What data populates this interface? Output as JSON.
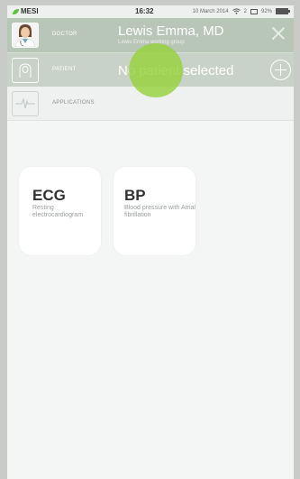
{
  "statusbar": {
    "brand": "MESI",
    "time": "16:32",
    "date": "10 March 2014",
    "mail_count": "2",
    "battery": "92%"
  },
  "doctor_row": {
    "label": "DOCTOR",
    "name": "Lewis Emma, MD",
    "group": "Lewis Emma working group"
  },
  "patient_row": {
    "label": "PATIENT",
    "status": "No patient selected"
  },
  "apps_row": {
    "label": "APPLICATIONS"
  },
  "apps": [
    {
      "title": "ECG",
      "desc": "Resting electrocardiogram"
    },
    {
      "title": "BP",
      "desc": "Blood pressure with Atrial fibrillation"
    }
  ],
  "icons": {
    "brand": "leaf-icon",
    "wifi": "wifi-icon",
    "mail": "mail-icon",
    "battery": "battery-icon",
    "doctor": "doctor-avatar",
    "patient": "patient-icon",
    "applications": "ecg-wave-icon",
    "close": "close-icon",
    "add": "add-circle-icon"
  },
  "colors": {
    "accent": "#8fcf3a",
    "header_green": "#b8c6b8"
  }
}
